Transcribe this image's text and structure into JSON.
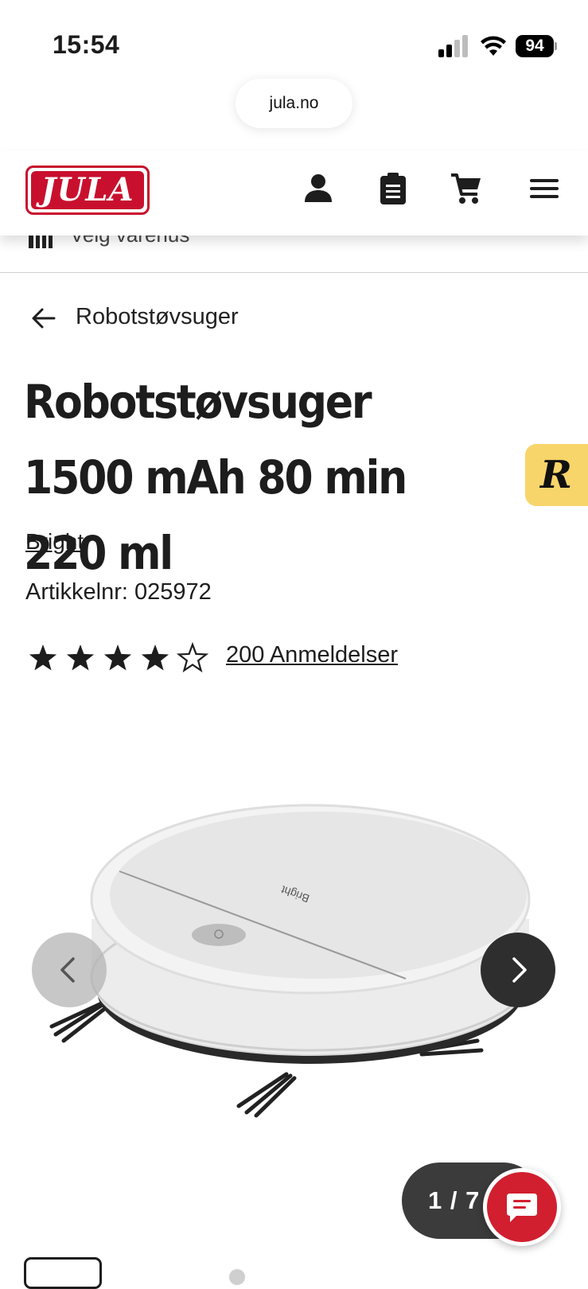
{
  "status_bar": {
    "time": "15:54",
    "battery": "94"
  },
  "browser": {
    "url": "jula.no"
  },
  "header": {
    "logo_text": "JULA",
    "icons": [
      "account-icon",
      "clipboard-icon",
      "cart-icon",
      "menu-icon"
    ]
  },
  "store_strip": {
    "label": "Velg varehus"
  },
  "breadcrumb": {
    "label": "Robotstøvsuger"
  },
  "product": {
    "title": "Robotstøvsuger 1500 mAh 80 min 220 ml",
    "brand": "Bright",
    "article_number": "Artikkelnr: 025972",
    "rating": 4,
    "rating_max": 5,
    "reviews_label": "200 Anmeldelser"
  },
  "gallery": {
    "counter": "1 / 7"
  },
  "badge": {
    "letter": "R"
  },
  "colors": {
    "brand_red": "#c8102e",
    "badge_yellow": "#f7d56a",
    "text": "#1d1d1d"
  }
}
